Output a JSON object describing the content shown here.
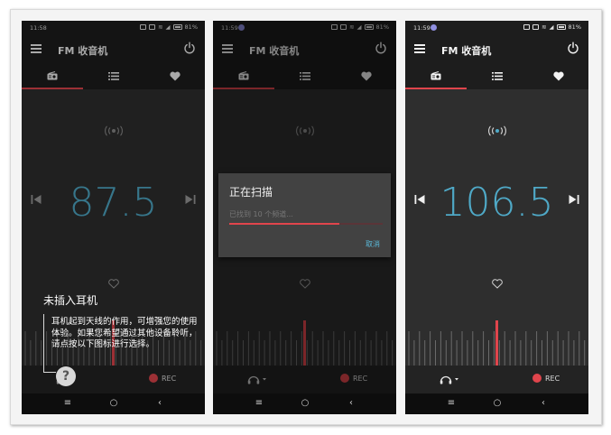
{
  "app": {
    "title": "FM 收音机",
    "accent_color": "#e0454c",
    "frequency_color": "#4fa9c7",
    "tabs": [
      {
        "icon": "radio-icon"
      },
      {
        "icon": "list-icon"
      },
      {
        "icon": "heart-icon"
      }
    ],
    "rec_label": "REC"
  },
  "screens": [
    {
      "status_time": "11:58",
      "battery": "81%",
      "frequency": "87.5",
      "overlay": {
        "title": "未插入耳机",
        "text": "耳机起到天线的作用，可增强您的使用体验。如果您希望通过其他设备聆听，请点按以下图标进行选择。",
        "help_glyph": "?"
      }
    },
    {
      "status_time": "11:59",
      "battery": "81%",
      "dialog": {
        "title": "正在扫描",
        "subtitle": "已找到 10 个频道...",
        "progress": 0.72,
        "cancel_label": "取消"
      }
    },
    {
      "status_time": "11:59",
      "battery": "81%",
      "frequency": "106.5"
    }
  ]
}
